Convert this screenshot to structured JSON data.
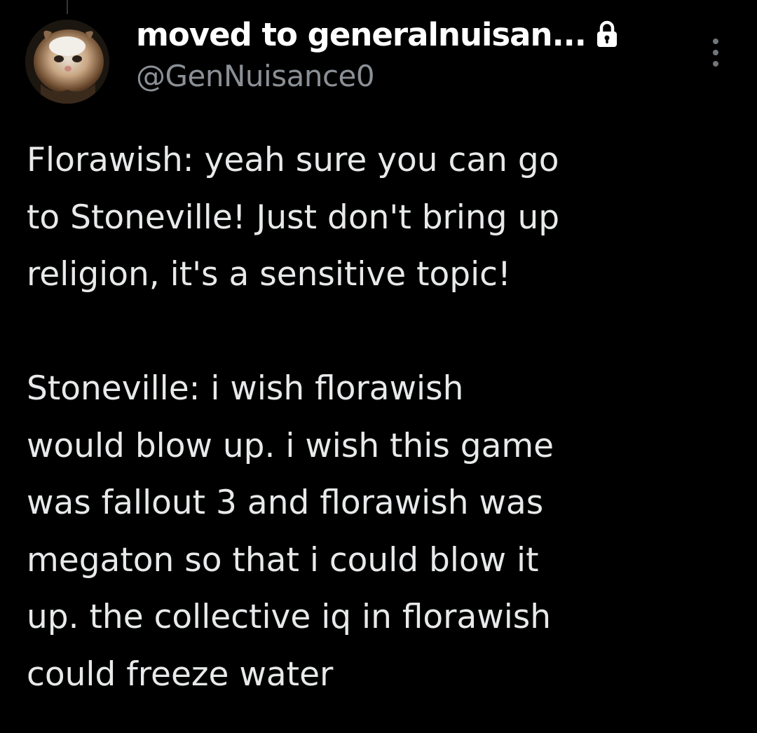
{
  "tweet": {
    "author": {
      "display_name": "moved to generalnuisan...",
      "handle": "@GenNuisance0",
      "protected": true,
      "avatar_icon": "cat-avatar"
    },
    "more_icon": "more-vertical-icon",
    "paragraphs": [
      "Florawish: yeah sure you can go\nto Stoneville! Just don't bring up\nreligion, it's a sensitive topic!",
      "Stoneville: i wish florawish\nwould blow up. i wish this game\nwas fallout 3 and florawish was\nmegaton so that i could blow it\nup. the collective iq in florawish\ncould freeze water"
    ]
  },
  "colors": {
    "background": "#000000",
    "text_primary": "#e7e9ea",
    "text_secondary": "#8b9096",
    "name": "#ffffff"
  }
}
